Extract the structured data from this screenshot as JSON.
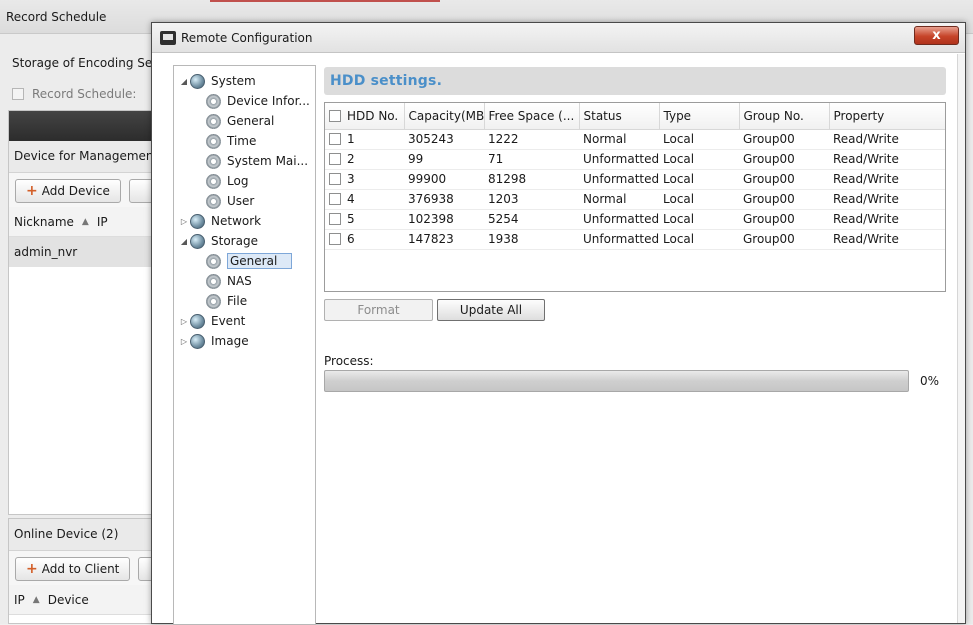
{
  "background": {
    "window_title": "Record Schedule",
    "storage_label": "Storage of Encoding Serv",
    "record_schedule_label": "Record Schedule:",
    "device_panel_title": "Device for Management (",
    "add_device_label": "Add Device",
    "columns": {
      "nickname": "Nickname",
      "ip": "IP"
    },
    "selected_device": "admin_nvr",
    "online_panel_title": "Online Device (2)",
    "add_to_client_label": "Add to Client",
    "online_columns": {
      "ip": "IP",
      "device": "Device"
    }
  },
  "dialog": {
    "title": "Remote Configuration",
    "close_label": "x",
    "tree": [
      {
        "id": "system",
        "label": "System",
        "level": 0,
        "expanded": true
      },
      {
        "id": "device-info",
        "label": "Device Infor...",
        "level": 1
      },
      {
        "id": "general-sys",
        "label": "General",
        "level": 1
      },
      {
        "id": "time",
        "label": "Time",
        "level": 1
      },
      {
        "id": "system-maint",
        "label": "System Mai...",
        "level": 1
      },
      {
        "id": "log",
        "label": "Log",
        "level": 1
      },
      {
        "id": "user",
        "label": "User",
        "level": 1
      },
      {
        "id": "network",
        "label": "Network",
        "level": 0,
        "expanded": false
      },
      {
        "id": "storage",
        "label": "Storage",
        "level": 0,
        "expanded": true
      },
      {
        "id": "general-storage",
        "label": "General",
        "level": 1,
        "selected": true
      },
      {
        "id": "nas",
        "label": "NAS",
        "level": 1
      },
      {
        "id": "file",
        "label": "File",
        "level": 1
      },
      {
        "id": "event",
        "label": "Event",
        "level": 0,
        "expanded": false
      },
      {
        "id": "image",
        "label": "Image",
        "level": 0,
        "expanded": false
      }
    ],
    "section_title": "HDD settings.",
    "table": {
      "headers": [
        "HDD No.",
        "Capacity(MB)",
        "Free Space (...",
        "Status",
        "Type",
        "Group No.",
        "Property"
      ],
      "rows": [
        [
          "1",
          "305243",
          "1222",
          "Normal",
          "Local",
          "Group00",
          "Read/Write"
        ],
        [
          "2",
          "99",
          "71",
          "Unformatted",
          "Local",
          "Group00",
          "Read/Write"
        ],
        [
          "3",
          "99900",
          "81298",
          "Unformatted",
          "Local",
          "Group00",
          "Read/Write"
        ],
        [
          "4",
          "376938",
          "1203",
          "Normal",
          "Local",
          "Group00",
          "Read/Write"
        ],
        [
          "5",
          "102398",
          "5254",
          "Unformatted",
          "Local",
          "Group00",
          "Read/Write"
        ],
        [
          "6",
          "147823",
          "1938",
          "Unformatted",
          "Local",
          "Group00",
          "Read/Write"
        ]
      ]
    },
    "format_label": "Format",
    "update_all_label": "Update All",
    "process_label": "Process:",
    "progress_value": 0,
    "progress_text": "0%"
  }
}
